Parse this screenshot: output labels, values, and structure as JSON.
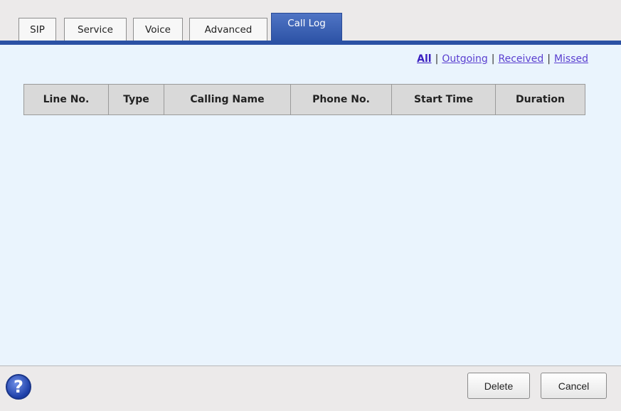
{
  "tabs": [
    {
      "label": "SIP",
      "active": false
    },
    {
      "label": "Service",
      "active": false
    },
    {
      "label": "Voice",
      "active": false
    },
    {
      "label": "Advanced",
      "active": false
    },
    {
      "label": "Call Log",
      "active": true
    }
  ],
  "filters": {
    "all": "All",
    "outgoing": "Outgoing",
    "received": "Received",
    "missed": "Missed",
    "separator": "|",
    "selected": "All"
  },
  "table": {
    "columns": [
      "Line No.",
      "Type",
      "Calling Name",
      "Phone No.",
      "Start Time",
      "Duration"
    ],
    "rows": []
  },
  "footer": {
    "help_symbol": "?",
    "delete_label": "Delete",
    "cancel_label": "Cancel"
  },
  "colors": {
    "accent": "#2b51a4",
    "content_bg": "#eaf4fd",
    "link": "#5a3fd0"
  },
  "icons": {
    "help": "help-icon"
  }
}
